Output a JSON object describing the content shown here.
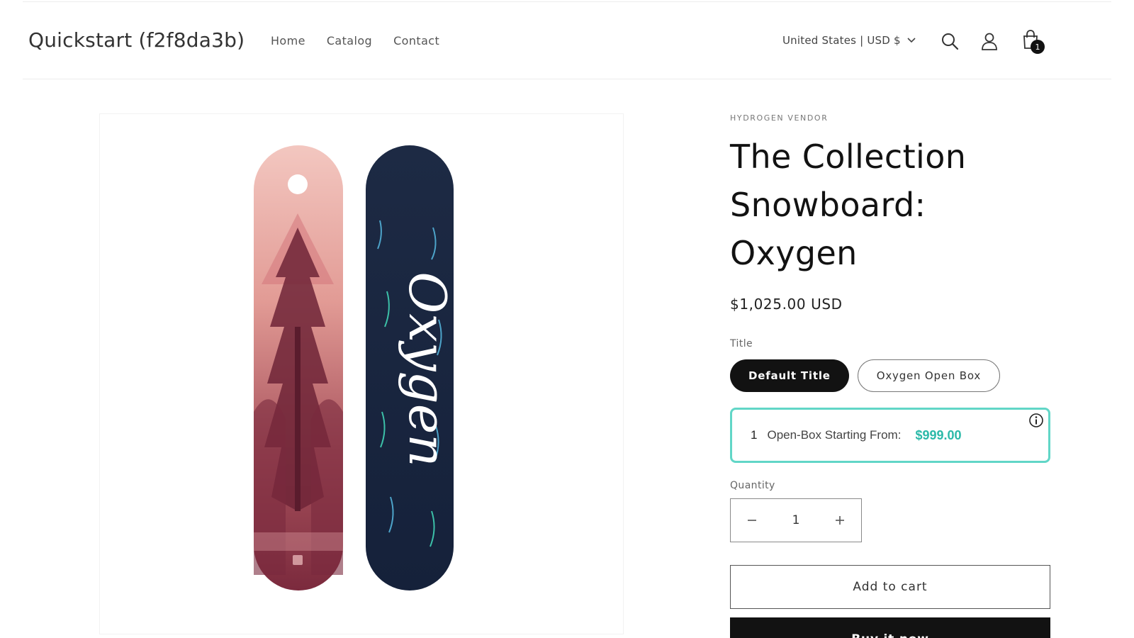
{
  "store": {
    "name": "Quickstart (f2f8da3b)"
  },
  "nav": {
    "items": [
      {
        "label": "Home"
      },
      {
        "label": "Catalog"
      },
      {
        "label": "Contact"
      }
    ]
  },
  "header": {
    "country_selector": "United States | USD $",
    "cart_count": "1",
    "icons": [
      "search-icon",
      "account-icon",
      "cart-icon"
    ]
  },
  "product": {
    "vendor": "HYDROGEN VENDOR",
    "title": "The Collection Snowboard: Oxygen",
    "price": "$1,025.00 USD",
    "option_label": "Title",
    "options": [
      {
        "label": "Default Title",
        "selected": true
      },
      {
        "label": "Oxygen Open Box",
        "selected": false
      }
    ],
    "image": {
      "board_text": "Oxygen"
    },
    "open_box": {
      "count": "1",
      "text": "Open-Box Starting From:",
      "price": "$999.00",
      "accent_color": "#61d6c7"
    },
    "quantity_label": "Quantity",
    "quantity_value": "1",
    "add_to_cart": "Add to cart",
    "buy_now": "Buy it now"
  }
}
